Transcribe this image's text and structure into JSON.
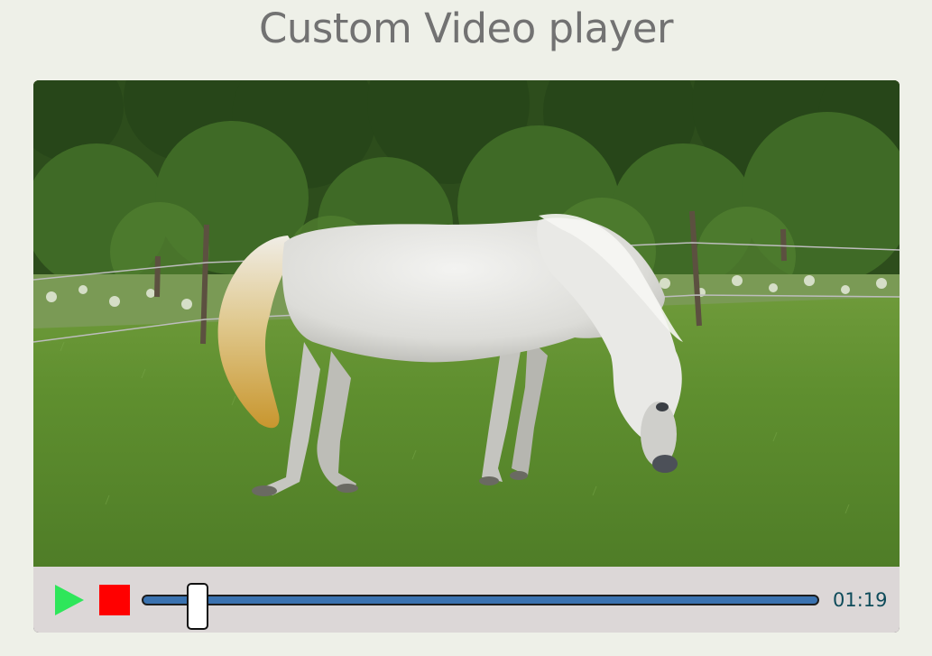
{
  "page": {
    "title": "Custom Video player"
  },
  "player": {
    "time_display": "01:19",
    "progress_fraction": 0.08,
    "controls": {
      "play_icon": "play-icon",
      "stop_icon": "stop-icon",
      "play_color": "#2ee65a",
      "stop_color": "#ff0000",
      "progress_color": "#3a72b0",
      "time_color": "#0e4b5a"
    }
  }
}
